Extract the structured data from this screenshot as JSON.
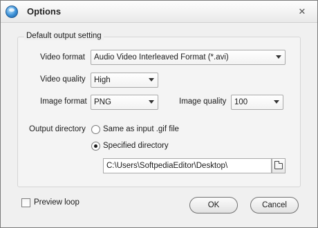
{
  "window": {
    "title": "Options",
    "close_glyph": "✕"
  },
  "icons": {
    "app": "app-globe-icon",
    "close": "close-icon",
    "browse": "folder-icon"
  },
  "group": {
    "title": "Default output setting"
  },
  "video_format": {
    "label": "Video format",
    "value": "Audio Video Interleaved Format (*.avi)"
  },
  "video_quality": {
    "label": "Video quality",
    "value": "High"
  },
  "image_format": {
    "label": "Image format",
    "value": "PNG"
  },
  "image_quality": {
    "label": "Image quality",
    "value": "100"
  },
  "output_directory": {
    "label": "Output directory",
    "options": [
      {
        "label": "Same as input .gif file",
        "checked": false
      },
      {
        "label": "Specified directory",
        "checked": true
      }
    ],
    "path": "C:\\Users\\SoftpediaEditor\\Desktop\\"
  },
  "preview_loop": {
    "label": "Preview loop",
    "checked": false
  },
  "buttons": {
    "ok": "OK",
    "cancel": "Cancel"
  }
}
